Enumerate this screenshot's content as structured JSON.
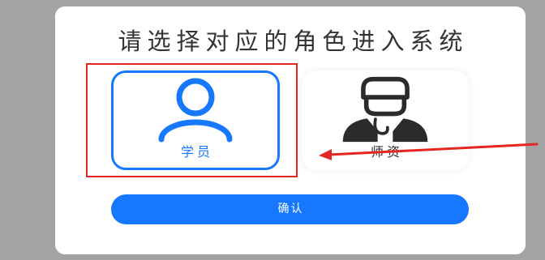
{
  "dialog": {
    "title": "请选择对应的角色进入系统",
    "roles": [
      {
        "label": "学员",
        "icon": "student-icon",
        "selected": true
      },
      {
        "label": "师资",
        "icon": "teacher-icon",
        "selected": false
      }
    ],
    "confirm_label": "确认"
  },
  "colors": {
    "backdrop": "#a3a3a3",
    "accent": "#1677ff",
    "text": "#333333",
    "icon_dark": "#2b2b2b",
    "annotation": "#e3261f"
  }
}
